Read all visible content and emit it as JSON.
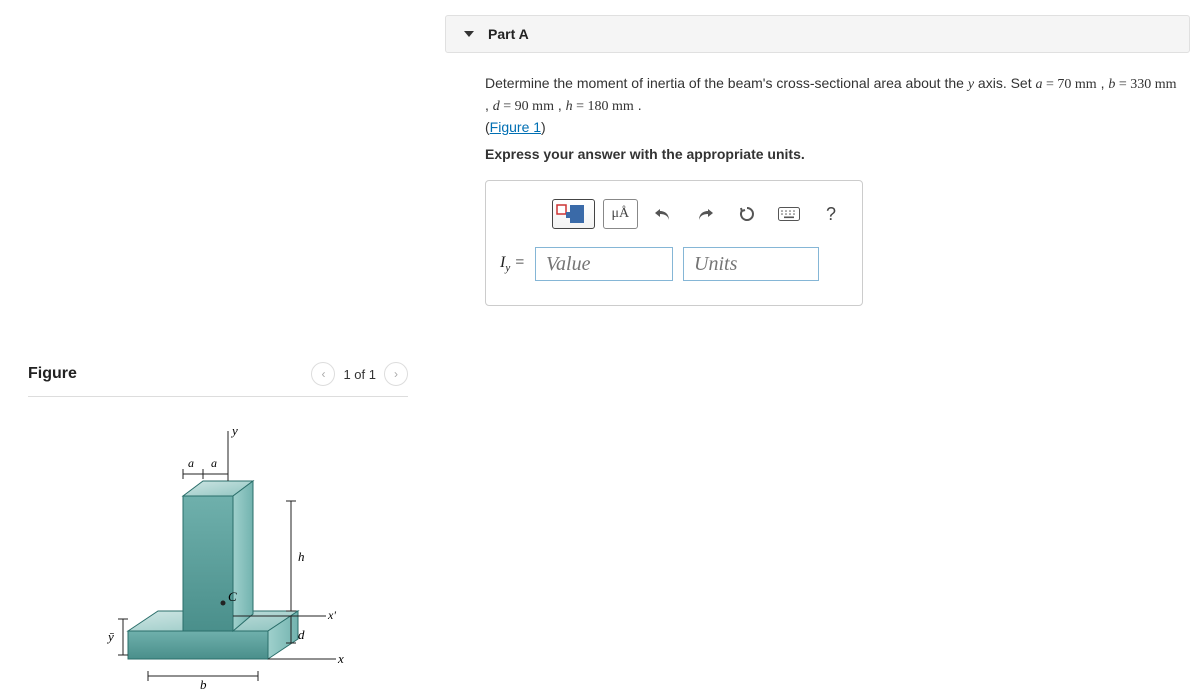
{
  "part": {
    "title": "Part A",
    "question_prefix": "Determine the moment of inertia of the beam's cross-sectional area about the ",
    "axis_var": "y",
    "axis_suffix": " axis. Set ",
    "a_var": "a",
    "a_eq": " = 70 mm",
    "b_var": "b",
    "b_eq": " = 330 mm",
    "d_var": "d",
    "d_eq": " = 90 mm",
    "h_var": "h",
    "h_eq": " = 180 mm",
    "period": " .",
    "figure_link": "Figure 1",
    "instruction": "Express your answer with the appropriate units.",
    "variable_label_html": "I<sub>y</sub> =",
    "value_placeholder": "Value",
    "units_placeholder": "Units",
    "ma_label": "μÅ",
    "help_label": "?"
  },
  "figure": {
    "title": "Figure",
    "page_label": "1 of 1",
    "labels": {
      "y": "y",
      "a": "a",
      "h": "h",
      "d": "d",
      "x": "x",
      "xprime": "x'",
      "b": "b",
      "C": "C",
      "ybar": "ȳ"
    }
  }
}
